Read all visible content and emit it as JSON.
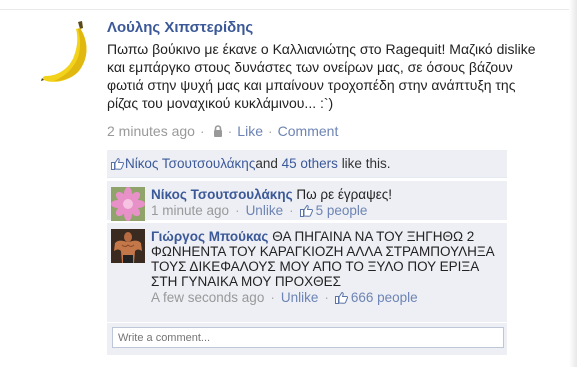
{
  "post": {
    "author": "Λούλης Χιπστερίδης",
    "message": "Πωπω βούκινο με έκανε ο Καλλιανιώτης στο Ragequit! Μαζικό dislike και εμπάργκο στους δυνάστες των ονείρων μας, σε όσους βάζουν φωτιά στην ψυχή μας και μπαίνουν τροχοπέδη στην ανάπτυξη της ρίζας του μοναχικού κυκλάμινου... :`)",
    "time": "2 minutes ago",
    "separator": "·",
    "like_label": "Like",
    "comment_label": "Comment"
  },
  "likes": {
    "liker": "Νίκος Τσουτσουλάκης",
    "and": "and",
    "others": "45 others",
    "suffix": "like this."
  },
  "comments": [
    {
      "name": "Νίκος Τσουτσουλάκης",
      "text": "Πω ρε έγραψες!",
      "time": "1 minute ago",
      "unlike": "Unlike",
      "likes": "5 people"
    },
    {
      "name": "Γιώργος Μπούκας",
      "text": "ΘΑ ΠΗΓΑΙΝΑ ΝΑ ΤΟΥ ΞΗΓΗΘΩ 2 ΦΩΝΗΕΝΤΑ ΤΟΥ ΚΑΡΑΓΚΙΟΖΗ ΑΛΛΑ ΣΤΡΑΜΠΟΥΛΗΞΑ ΤΟΥΣ ΔΙΚΕΦΑΛΟΥΣ ΜΟΥ ΑΠΟ ΤΟ ΞΥΛΟ ΠΟΥ ΕΡΙΞΑ ΣΤΗ ΓΥΝΑΙΚΑ ΜΟΥ ΠΡΟΧΘΕΣ",
      "time": "A few seconds ago",
      "unlike": "Unlike",
      "likes": "666 people"
    }
  ],
  "composer": {
    "placeholder": "Write a comment..."
  },
  "colors": {
    "link": "#3b5998",
    "meta_link": "#6d84b4",
    "ufi_bg": "#edeff4"
  },
  "icons": [
    "banana-avatar",
    "lock-icon",
    "thumbs-up-icon",
    "flower-avatar",
    "bodybuilder-avatar"
  ]
}
